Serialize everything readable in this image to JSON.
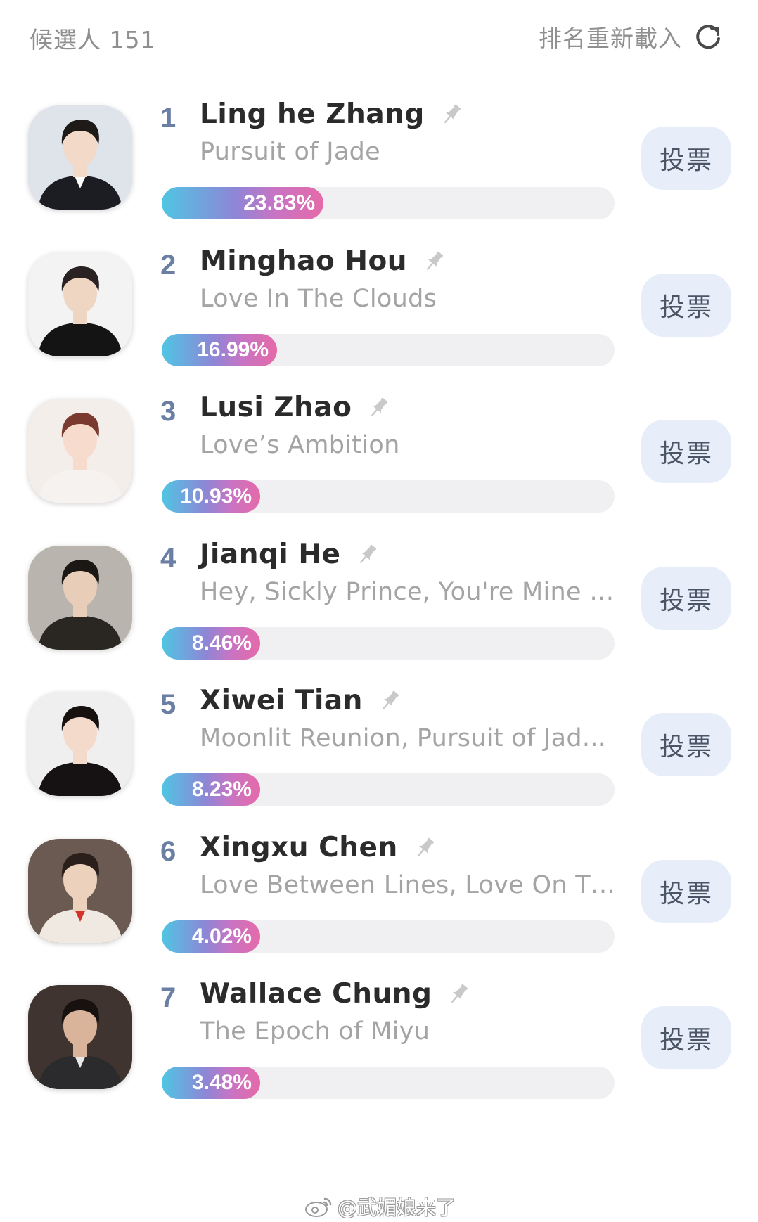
{
  "header": {
    "candidate_count": "候選人 151",
    "reload_label": "排名重新載入",
    "reload_icon": "refresh-icon"
  },
  "candidates": [
    {
      "rank": "1",
      "name": "Ling he Zhang",
      "works": "Pursuit of Jade",
      "percent_label": "23.83%",
      "percent": 23.83,
      "vote_label": "投票",
      "avatar": {
        "bg": "#dfe3ea",
        "outfit": "#1c1d22",
        "hair": "#1e1a18",
        "skin": "#f2d9c8",
        "accent": "#ffffff"
      }
    },
    {
      "rank": "2",
      "name": "Minghao Hou",
      "works": "Love In The Clouds",
      "percent_label": "16.99%",
      "percent": 16.99,
      "vote_label": "投票",
      "avatar": {
        "bg": "#f3f3f3",
        "outfit": "#141414",
        "hair": "#2a2222",
        "skin": "#efd6c3",
        "accent": "#141414"
      }
    },
    {
      "rank": "3",
      "name": "Lusi Zhao",
      "works": "Love’s Ambition",
      "percent_label": "10.93%",
      "percent": 10.93,
      "vote_label": "投票",
      "avatar": {
        "bg": "#f4eeea",
        "outfit": "#f6f2f0",
        "hair": "#7a3a30",
        "skin": "#f7dccd",
        "accent": "#f6f2f0"
      }
    },
    {
      "rank": "4",
      "name": "Jianqi He",
      "works": "Hey, Sickly Prince, You're Mine t...",
      "percent_label": "8.46%",
      "percent": 8.46,
      "vote_label": "投票",
      "avatar": {
        "bg": "#b9b4ad",
        "outfit": "#2a2622",
        "hair": "#1b1714",
        "skin": "#e8cdb9",
        "accent": "#2a2622"
      }
    },
    {
      "rank": "5",
      "name": "Xiwei Tian",
      "works": "Moonlit Reunion, Pursuit of Jad...",
      "percent_label": "8.23%",
      "percent": 8.23,
      "vote_label": "投票",
      "avatar": {
        "bg": "#efefef",
        "outfit": "#161213",
        "hair": "#16110f",
        "skin": "#f4dacb",
        "accent": "#161213"
      }
    },
    {
      "rank": "6",
      "name": "Xingxu Chen",
      "works": "Love Between Lines, Love On Th...",
      "percent_label": "4.02%",
      "percent": 4.02,
      "vote_label": "投票",
      "avatar": {
        "bg": "#6b5a52",
        "outfit": "#efe9e2",
        "hair": "#2a1f1a",
        "skin": "#ecd1bd",
        "accent": "#d4332b"
      }
    },
    {
      "rank": "7",
      "name": "Wallace Chung",
      "works": "The Epoch of Miyu",
      "percent_label": "3.48%",
      "percent": 3.48,
      "vote_label": "投票",
      "avatar": {
        "bg": "#3f342f",
        "outfit": "#2b2b2e",
        "hair": "#17120f",
        "skin": "#d9b49a",
        "accent": "#e8e8e8"
      }
    }
  ],
  "icons": {
    "pin": "pin-icon",
    "avatar": "avatar-photo"
  },
  "colors": {
    "bar_gradient_start": "#4fc6e3",
    "bar_gradient_end": "#e56aa8",
    "bar_track": "#f0f0f2",
    "vote_button_bg": "#e7eefa",
    "rank_color": "#6a7fa3"
  },
  "watermark": {
    "text": "@武媚娘来了",
    "logo": "weibo-logo"
  }
}
